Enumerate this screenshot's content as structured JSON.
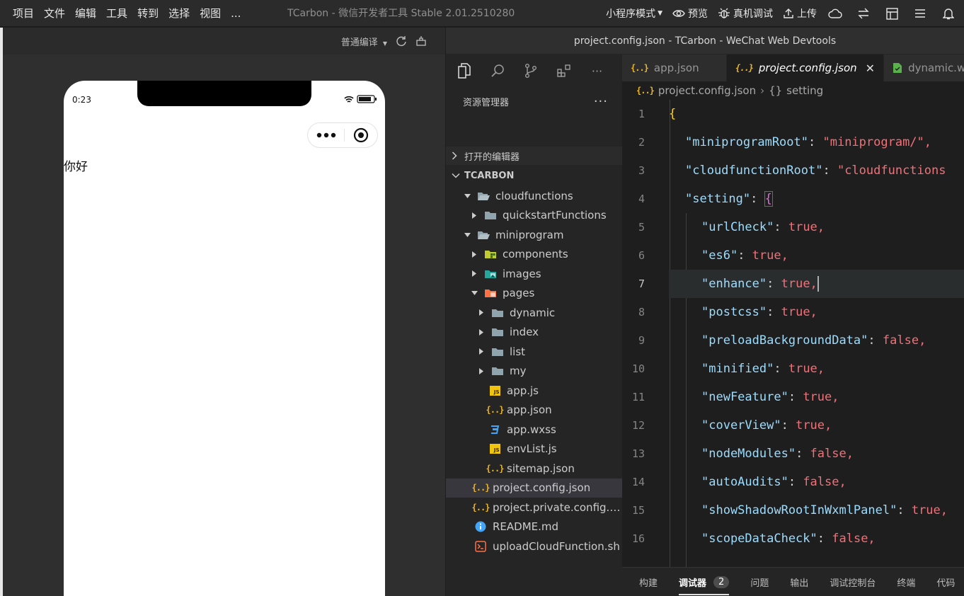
{
  "menubar": {
    "items": [
      "项目",
      "文件",
      "编辑",
      "工具",
      "转到",
      "选择",
      "视图",
      "..."
    ],
    "app_title": "TCarbon - 微信开发者工具 Stable 2.01.2510280"
  },
  "toolbar": {
    "mode_label": "小程序模式",
    "preview_label": "预览",
    "real_debug_label": "真机调试",
    "upload_label": "上传"
  },
  "simulator": {
    "compile_mode": "普通编译",
    "status_time": "0:23",
    "page_text": "你好"
  },
  "window": {
    "title": "project.config.json - TCarbon - WeChat Web Devtools"
  },
  "explorer": {
    "title": "资源管理器",
    "more": "···",
    "open_editors": "打开的编辑器",
    "project_name": "TCARBON",
    "tree": [
      {
        "label": "cloudfunctions",
        "depth": 1,
        "type": "folder-open",
        "arrow": "down"
      },
      {
        "label": "quickstartFunctions",
        "depth": 2,
        "type": "folder",
        "arrow": "right"
      },
      {
        "label": "miniprogram",
        "depth": 1,
        "type": "folder-open",
        "arrow": "down"
      },
      {
        "label": "components",
        "depth": 2,
        "type": "folder-components",
        "arrow": "right"
      },
      {
        "label": "images",
        "depth": 2,
        "type": "folder-images",
        "arrow": "right"
      },
      {
        "label": "pages",
        "depth": 2,
        "type": "folder-pages",
        "arrow": "down"
      },
      {
        "label": "dynamic",
        "depth": 3,
        "type": "folder",
        "arrow": "right"
      },
      {
        "label": "index",
        "depth": 3,
        "type": "folder",
        "arrow": "right"
      },
      {
        "label": "list",
        "depth": 3,
        "type": "folder",
        "arrow": "right"
      },
      {
        "label": "my",
        "depth": 3,
        "type": "folder",
        "arrow": "right"
      },
      {
        "label": "app.js",
        "depth": 3,
        "type": "js",
        "arrow": "none"
      },
      {
        "label": "app.json",
        "depth": 3,
        "type": "json",
        "arrow": "none"
      },
      {
        "label": "app.wxss",
        "depth": 3,
        "type": "css",
        "arrow": "none"
      },
      {
        "label": "envList.js",
        "depth": 3,
        "type": "js",
        "arrow": "none"
      },
      {
        "label": "sitemap.json",
        "depth": 3,
        "type": "json",
        "arrow": "none"
      },
      {
        "label": "project.config.json",
        "depth": 2,
        "type": "json",
        "arrow": "none",
        "selected": true
      },
      {
        "label": "project.private.config.js...",
        "depth": 2,
        "type": "json",
        "arrow": "none"
      },
      {
        "label": "README.md",
        "depth": 2,
        "type": "info",
        "arrow": "none"
      },
      {
        "label": "uploadCloudFunction.sh",
        "depth": 2,
        "type": "shell",
        "arrow": "none"
      }
    ]
  },
  "editor": {
    "tabs": [
      {
        "label": "app.json",
        "icon": "json",
        "active": false
      },
      {
        "label": "project.config.json",
        "icon": "json",
        "active": true
      },
      {
        "label": "dynamic.wxml",
        "icon": "wxml",
        "active": false
      }
    ],
    "breadcrumb": {
      "file": "project.config.json",
      "symbol": "setting"
    },
    "current_line": 7,
    "lines": [
      {
        "n": 1,
        "indent": 0,
        "key": "",
        "value": "{",
        "vtype": "brace1"
      },
      {
        "n": 2,
        "indent": 1,
        "key": "\"miniprogramRoot\"",
        "value": "\"miniprogram/\",",
        "vtype": "s2"
      },
      {
        "n": 3,
        "indent": 1,
        "key": "\"cloudfunctionRoot\"",
        "value": "\"cloudfunctions",
        "vtype": "s2"
      },
      {
        "n": 4,
        "indent": 1,
        "key": "\"setting\"",
        "value": "{",
        "vtype": "brace2"
      },
      {
        "n": 5,
        "indent": 2,
        "key": "\"urlCheck\"",
        "value": "true,",
        "vtype": "b"
      },
      {
        "n": 6,
        "indent": 2,
        "key": "\"es6\"",
        "value": "true,",
        "vtype": "b"
      },
      {
        "n": 7,
        "indent": 2,
        "key": "\"enhance\"",
        "value": "true,",
        "vtype": "b"
      },
      {
        "n": 8,
        "indent": 2,
        "key": "\"postcss\"",
        "value": "true,",
        "vtype": "b"
      },
      {
        "n": 9,
        "indent": 2,
        "key": "\"preloadBackgroundData\"",
        "value": "false,",
        "vtype": "b"
      },
      {
        "n": 10,
        "indent": 2,
        "key": "\"minified\"",
        "value": "true,",
        "vtype": "b"
      },
      {
        "n": 11,
        "indent": 2,
        "key": "\"newFeature\"",
        "value": "true,",
        "vtype": "b"
      },
      {
        "n": 12,
        "indent": 2,
        "key": "\"coverView\"",
        "value": "true,",
        "vtype": "b"
      },
      {
        "n": 13,
        "indent": 2,
        "key": "\"nodeModules\"",
        "value": "false,",
        "vtype": "b"
      },
      {
        "n": 14,
        "indent": 2,
        "key": "\"autoAudits\"",
        "value": "false,",
        "vtype": "b"
      },
      {
        "n": 15,
        "indent": 2,
        "key": "\"showShadowRootInWxmlPanel\"",
        "value": "true,",
        "vtype": "b"
      },
      {
        "n": 16,
        "indent": 2,
        "key": "\"scopeDataCheck\"",
        "value": "false,",
        "vtype": "b"
      }
    ]
  },
  "bottom_panel": {
    "tabs": [
      {
        "label": "构建",
        "active": false
      },
      {
        "label": "调试器",
        "active": true,
        "count": "2"
      },
      {
        "label": "问题",
        "active": false
      },
      {
        "label": "输出",
        "active": false
      },
      {
        "label": "调试控制台",
        "active": false
      },
      {
        "label": "终端",
        "active": false
      },
      {
        "label": "代码",
        "active": false
      }
    ]
  }
}
